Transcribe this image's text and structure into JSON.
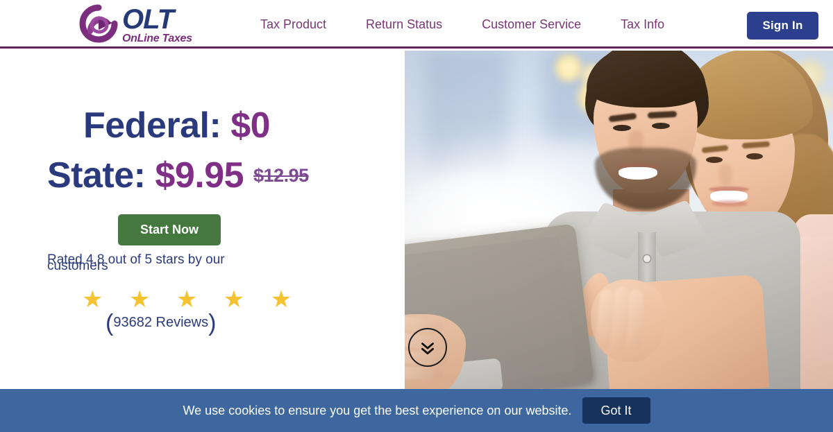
{
  "header": {
    "logo": {
      "mark": "circular-arrow-icon",
      "primary": "OLT",
      "secondary": "OnLine Taxes"
    },
    "nav": [
      {
        "label": "Tax Product"
      },
      {
        "label": "Return Status"
      },
      {
        "label": "Customer Service"
      },
      {
        "label": "Tax Info"
      }
    ],
    "sign_in_label": "Sign In",
    "border_color": "#5f2561",
    "sign_in_color": "#2b3f8e"
  },
  "hero": {
    "federal_label": "Federal: ",
    "federal_price": "$0",
    "state_label": "State: ",
    "state_price": "$9.95",
    "state_old_price": "$12.95",
    "cta_label": "Start Now",
    "cta_color": "#44783f",
    "rating_text": "Rated 4.8 out of 5 stars by our customers",
    "stars": "★ ★ ★ ★ ★",
    "star_color": "#f5c331",
    "reviews_open": "(",
    "reviews_count": "93682 Reviews",
    "reviews_close": ")",
    "label_color": "#2b3a7c",
    "price_color": "#7f2f86",
    "image_alt": "Smiling couple looking at a tablet",
    "scroll_icon": "double-chevron-down-icon"
  },
  "cookie": {
    "message": "We use cookies to ensure you get the best experience on our website.",
    "button_label": "Got It",
    "bar_color": "#3d679e",
    "button_color": "#16325c"
  }
}
